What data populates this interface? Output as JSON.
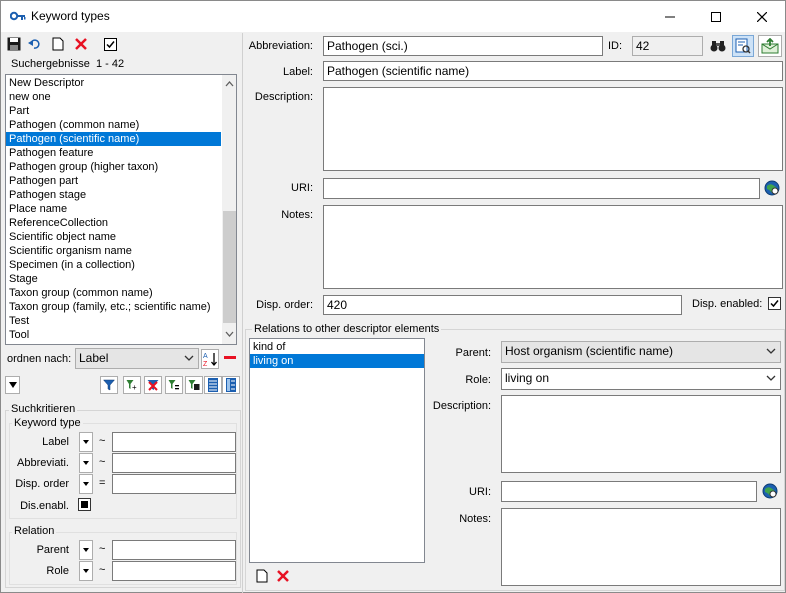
{
  "window": {
    "title": "Keyword types",
    "minimize": "—",
    "maximize": "☐",
    "close": "✕"
  },
  "left": {
    "results_label": "Suchergebnisse",
    "results_range": "1 - 42",
    "items": [
      "New Descriptor",
      "new one",
      "Part",
      "Pathogen (common name)",
      "Pathogen (scientific name)",
      "Pathogen feature",
      "Pathogen group (higher taxon)",
      "Pathogen part",
      "Pathogen stage",
      "Place name",
      "ReferenceCollection",
      "Scientific object name",
      "Scientific organism name",
      "Specimen (in a collection)",
      "Stage",
      "Taxon group (common name)",
      "Taxon group (family, etc.; scientific name)",
      "Test",
      "Tool"
    ],
    "selected_index": 4,
    "sort_label": "ordnen nach:",
    "sort_value": "Label",
    "search_criteria": "Suchkritieren",
    "keyword_type_group": "Keyword type",
    "criteria": [
      {
        "label": "Label",
        "op": "~",
        "value": ""
      },
      {
        "label": "Abbreviati.",
        "op": "~",
        "value": ""
      },
      {
        "label": "Disp. order",
        "op": "=",
        "value": ""
      }
    ],
    "dis_enabl_label": "Dis.enabl.",
    "relation_group": "Relation",
    "relation_criteria": [
      {
        "label": "Parent",
        "op": "~",
        "value": ""
      },
      {
        "label": "Role",
        "op": "~",
        "value": ""
      }
    ]
  },
  "right": {
    "abbreviation_label": "Abbreviation:",
    "abbreviation_value": "Pathogen (sci.)",
    "id_label": "ID:",
    "id_value": "42",
    "label_label": "Label:",
    "label_value": "Pathogen (scientific name)",
    "description_label": "Description:",
    "description_value": "",
    "uri_label": "URI:",
    "uri_value": "",
    "notes_label": "Notes:",
    "notes_value": "",
    "disp_order_label": "Disp. order:",
    "disp_order_value": "420",
    "disp_enabled_label": "Disp. enabled:",
    "disp_enabled_checked": true
  },
  "relations": {
    "title": "Relations to other descriptor elements",
    "items": [
      "kind of",
      "living on"
    ],
    "selected_index": 1,
    "parent_label": "Parent:",
    "parent_value": "Host organism (scientific name)",
    "role_label": "Role:",
    "role_value": "living on",
    "description_label": "Description:",
    "description_value": "",
    "uri_label": "URI:",
    "uri_value": "",
    "notes_label": "Notes:",
    "notes_value": ""
  },
  "colors": {
    "selection": "#0078d7",
    "delete_red": "#e81123",
    "accent_blue": "#1c5fb0"
  }
}
